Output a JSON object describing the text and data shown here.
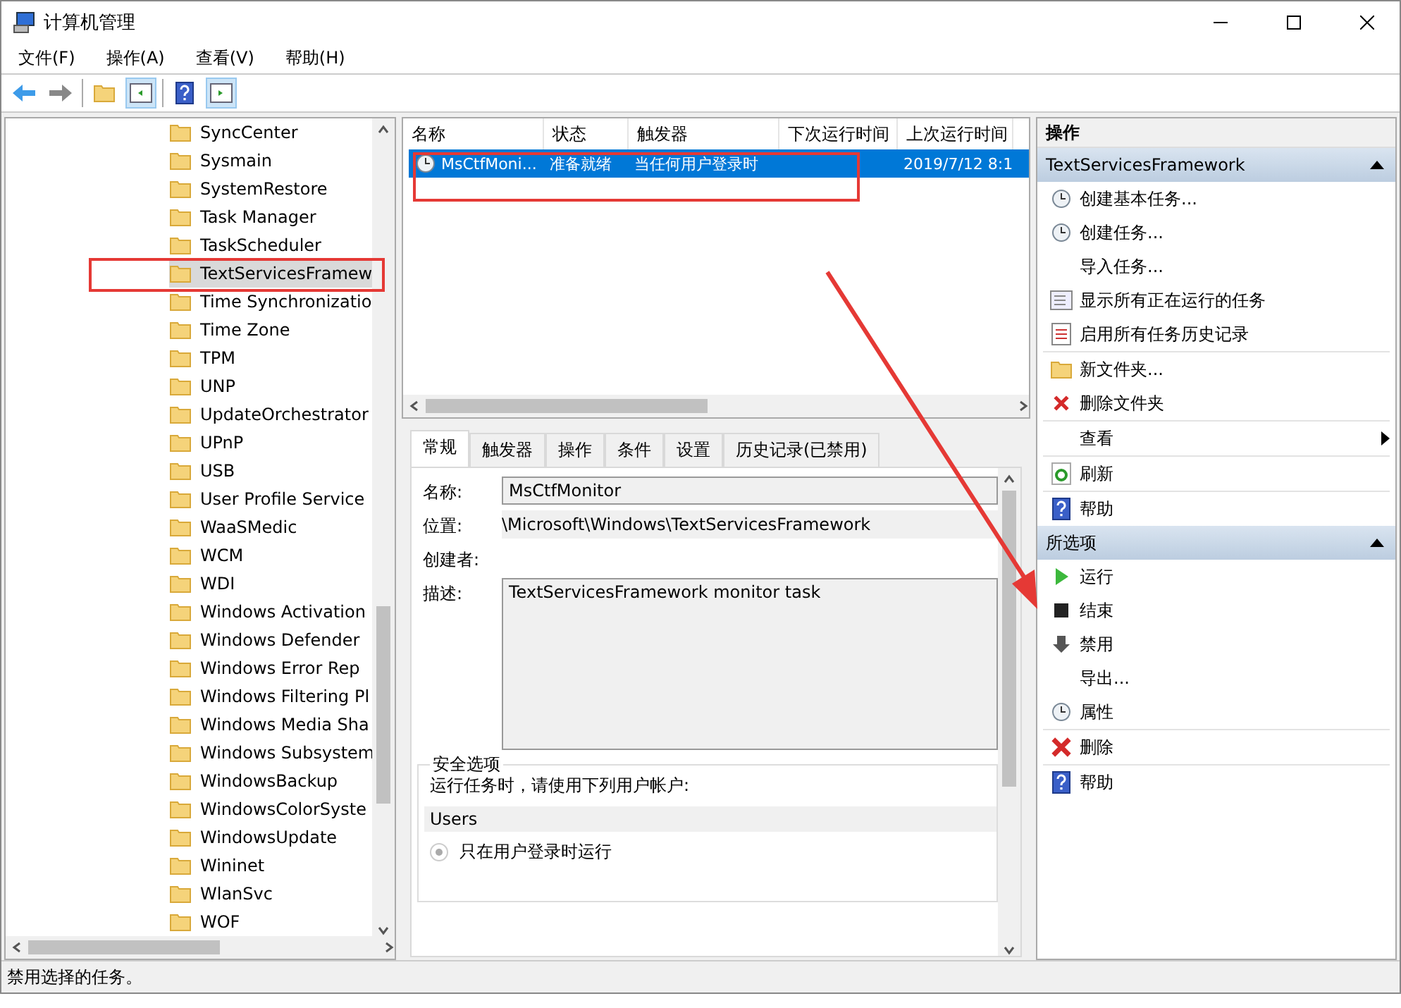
{
  "window": {
    "title": "计算机管理"
  },
  "menu": [
    "文件(F)",
    "操作(A)",
    "查看(V)",
    "帮助(H)"
  ],
  "tree": {
    "items": [
      {
        "label": "SyncCenter",
        "selected": false
      },
      {
        "label": "Sysmain",
        "selected": false
      },
      {
        "label": "SystemRestore",
        "selected": false
      },
      {
        "label": "Task Manager",
        "selected": false
      },
      {
        "label": "TaskScheduler",
        "selected": false
      },
      {
        "label": "TextServicesFramew",
        "selected": true
      },
      {
        "label": "Time Synchronizatio",
        "selected": false
      },
      {
        "label": "Time Zone",
        "selected": false
      },
      {
        "label": "TPM",
        "selected": false
      },
      {
        "label": "UNP",
        "selected": false
      },
      {
        "label": "UpdateOrchestrator",
        "selected": false
      },
      {
        "label": "UPnP",
        "selected": false
      },
      {
        "label": "USB",
        "selected": false
      },
      {
        "label": "User Profile Service",
        "selected": false
      },
      {
        "label": "WaaSMedic",
        "selected": false
      },
      {
        "label": "WCM",
        "selected": false
      },
      {
        "label": "WDI",
        "selected": false
      },
      {
        "label": "Windows Activation",
        "selected": false
      },
      {
        "label": "Windows Defender",
        "selected": false
      },
      {
        "label": "Windows Error Rep",
        "selected": false
      },
      {
        "label": "Windows Filtering Pl",
        "selected": false
      },
      {
        "label": "Windows Media Sha",
        "selected": false
      },
      {
        "label": "Windows Subsystem",
        "selected": false
      },
      {
        "label": "WindowsBackup",
        "selected": false
      },
      {
        "label": "WindowsColorSyste",
        "selected": false
      },
      {
        "label": "WindowsUpdate",
        "selected": false
      },
      {
        "label": "Wininet",
        "selected": false
      },
      {
        "label": "WlanSvc",
        "selected": false
      },
      {
        "label": "WOF",
        "selected": false
      }
    ]
  },
  "task_table": {
    "columns": [
      "名称",
      "状态",
      "触发器",
      "下次运行时间",
      "上次运行时间"
    ],
    "rows": [
      {
        "cells": [
          "MsCtfMoni...",
          "准备就绪",
          "当任何用户登录时",
          "",
          "2019/7/12 8:1"
        ],
        "selected": true
      }
    ]
  },
  "details": {
    "tabs": [
      {
        "label": "常规",
        "selected": true
      },
      {
        "label": "触发器",
        "selected": false
      },
      {
        "label": "操作",
        "selected": false
      },
      {
        "label": "条件",
        "selected": false
      },
      {
        "label": "设置",
        "selected": false
      },
      {
        "label": "历史记录(已禁用)",
        "selected": false
      }
    ],
    "name_label": "名称:",
    "name_value": "MsCtfMonitor",
    "location_label": "位置:",
    "location_value": "\\Microsoft\\Windows\\TextServicesFramework",
    "author_label": "创建者:",
    "description_label": "描述:",
    "description_value": "TextServicesFramework monitor task",
    "security": {
      "title": "安全选项",
      "prompt": "运行任务时，请使用下列用户帐户:",
      "account": "Users",
      "options": [
        {
          "label": "只在用户登录时运行",
          "selected": true
        }
      ]
    }
  },
  "actions": {
    "title": "操作",
    "sections": [
      {
        "title": "TextServicesFramework",
        "expanded": true,
        "items": [
          {
            "label": "创建基本任务...",
            "kind": "action",
            "divider_before": false
          },
          {
            "label": "创建任务...",
            "kind": "action",
            "divider_before": false
          },
          {
            "label": "导入任务...",
            "kind": "action",
            "divider_before": false
          },
          {
            "label": "显示所有正在运行的任务",
            "kind": "action",
            "divider_before": false
          },
          {
            "label": "启用所有任务历史记录",
            "kind": "action",
            "divider_before": false
          },
          {
            "label": "新文件夹...",
            "kind": "action",
            "divider_before": true
          },
          {
            "label": "删除文件夹",
            "kind": "action",
            "divider_before": false
          },
          {
            "label": "查看",
            "kind": "submenu",
            "divider_before": true
          },
          {
            "label": "刷新",
            "kind": "action",
            "divider_before": true
          },
          {
            "label": "帮助",
            "kind": "action",
            "divider_before": true
          }
        ]
      },
      {
        "title": "所选项",
        "expanded": true,
        "items": [
          {
            "label": "运行",
            "kind": "action",
            "divider_before": false
          },
          {
            "label": "结束",
            "kind": "action",
            "divider_before": false
          },
          {
            "label": "禁用",
            "kind": "action",
            "divider_before": false
          },
          {
            "label": "导出...",
            "kind": "action",
            "divider_before": false
          },
          {
            "label": "属性",
            "kind": "action",
            "divider_before": false
          },
          {
            "label": "删除",
            "kind": "action",
            "divider_before": true
          },
          {
            "label": "帮助",
            "kind": "action",
            "divider_before": true
          }
        ]
      }
    ]
  },
  "status_bar": {
    "text": "禁用选择的任务。"
  }
}
